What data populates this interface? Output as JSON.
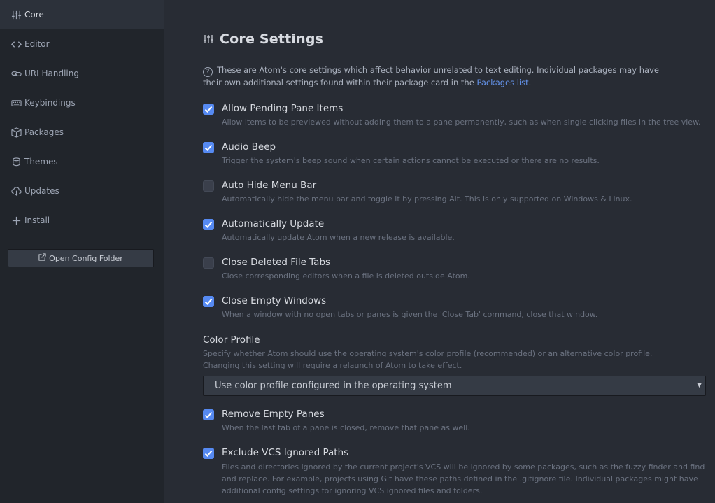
{
  "sidebar": {
    "items": [
      {
        "label": "Core",
        "icon": "sliders-icon",
        "active": true
      },
      {
        "label": "Editor",
        "icon": "code-icon"
      },
      {
        "label": "URI Handling",
        "icon": "link-icon"
      },
      {
        "label": "Keybindings",
        "icon": "keyboard-icon"
      },
      {
        "label": "Packages",
        "icon": "package-icon"
      },
      {
        "label": "Themes",
        "icon": "paintcan-icon"
      },
      {
        "label": "Updates",
        "icon": "cloud-download-icon"
      },
      {
        "label": "Install",
        "icon": "plus-icon"
      }
    ],
    "open_config_label": "Open Config Folder"
  },
  "main": {
    "title": "Core Settings",
    "intro_text": "These are Atom's core settings which affect behavior unrelated to text editing. Individual packages may have their own additional settings found within their package card in the",
    "intro_link": "Packages list",
    "intro_end": ".",
    "settings": [
      {
        "title": "Allow Pending Pane Items",
        "desc": "Allow items to be previewed without adding them to a pane permanently, such as when single clicking files in the tree view.",
        "checked": true
      },
      {
        "title": "Audio Beep",
        "desc": "Trigger the system's beep sound when certain actions cannot be executed or there are no results.",
        "checked": true
      },
      {
        "title": "Auto Hide Menu Bar",
        "desc": "Automatically hide the menu bar and toggle it by pressing Alt. This is only supported on Windows & Linux.",
        "checked": false
      },
      {
        "title": "Automatically Update",
        "desc": "Automatically update Atom when a new release is available.",
        "checked": true
      },
      {
        "title": "Close Deleted File Tabs",
        "desc": "Close corresponding editors when a file is deleted outside Atom.",
        "checked": false
      },
      {
        "title": "Close Empty Windows",
        "desc": "When a window with no open tabs or panes is given the 'Close Tab' command, close that window.",
        "checked": true
      }
    ],
    "color_profile": {
      "title": "Color Profile",
      "desc_line1": "Specify whether Atom should use the operating system's color profile (recommended) or an alternative color profile.",
      "desc_line2": "Changing this setting will require a relaunch of Atom to take effect.",
      "selected": "Use color profile configured in the operating system"
    },
    "remove_empty_panes": {
      "title": "Remove Empty Panes",
      "desc": "When the last tab of a pane is closed, remove that pane as well.",
      "checked": true
    },
    "exclude_vcs": {
      "title": "Exclude VCS Ignored Paths",
      "desc": "Files and directories ignored by the current project's VCS will be ignored by some packages, such as the fuzzy finder and find and replace. For example, projects using Git have these paths defined in the .gitignore file. Individual packages might have additional config settings for ignoring VCS ignored files and folders.",
      "checked": true
    }
  },
  "colors": {
    "accent": "#568af2",
    "link": "#6494ed"
  }
}
